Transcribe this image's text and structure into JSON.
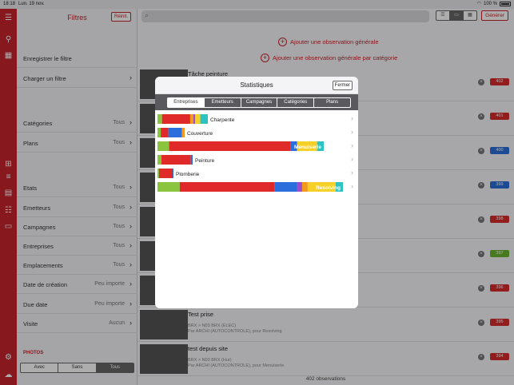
{
  "status_bar": {
    "time": "18:18",
    "date": "Lun. 19 nov.",
    "battery": "100 %"
  },
  "filters": {
    "title": "Filtres",
    "reset_label": "Réinit.",
    "rows": [
      {
        "label": "Enregistrer le filtre",
        "value": "",
        "chevron": false
      },
      {
        "label": "Charger un filtre",
        "value": "",
        "chevron": true
      },
      {
        "label": "Catégories",
        "value": "Tous",
        "chevron": true
      },
      {
        "label": "Plans",
        "value": "Tous",
        "chevron": true
      },
      {
        "label": "Etats",
        "value": "Tous",
        "chevron": true
      },
      {
        "label": "Emetteurs",
        "value": "Tous",
        "chevron": true
      },
      {
        "label": "Campagnes",
        "value": "Tous",
        "chevron": true
      },
      {
        "label": "Entreprises",
        "value": "Tous",
        "chevron": true
      },
      {
        "label": "Emplacements",
        "value": "Tous",
        "chevron": true
      },
      {
        "label": "Date de création",
        "value": "Peu importe",
        "chevron": true
      },
      {
        "label": "Due date",
        "value": "Peu importe",
        "chevron": true
      },
      {
        "label": "Visite",
        "value": "Aucun",
        "chevron": true
      }
    ],
    "photos_label": "PHOTOS",
    "photos_options": [
      "Avec",
      "Sans",
      "Tous"
    ],
    "photos_selected": "Tous"
  },
  "toolbar": {
    "search_placeholder": "",
    "generate_label": "Générer",
    "add_general": "Ajouter une observation générale",
    "add_by_category": "Ajouter une observation générale par catégorie"
  },
  "observations": [
    {
      "name": "Tâche peinture",
      "sub1": "",
      "sub2": "",
      "num": "402",
      "color": "#d72b2b"
    },
    {
      "name": "",
      "sub1": "",
      "sub2": "",
      "num": "401",
      "color": "#d72b2b"
    },
    {
      "name": "",
      "sub1": "",
      "sub2": "",
      "num": "400",
      "color": "#2a6fdb"
    },
    {
      "name": "",
      "sub1": "",
      "sub2": "",
      "num": "399",
      "color": "#2a6fdb"
    },
    {
      "name": "",
      "sub1": "",
      "sub2": "",
      "num": "398",
      "color": "#d72b2b"
    },
    {
      "name": "",
      "sub1": "",
      "sub2": "",
      "num": "397",
      "color": "#6ab52e"
    },
    {
      "name": "",
      "sub1": "",
      "sub2": "",
      "num": "396",
      "color": "#d72b2b"
    },
    {
      "name": "Test prise",
      "sub1": "BRX > N03 BRX (ELEC)",
      "sub2": "Par ARCHI (AUTOCONTROLE), pour Resolving",
      "num": "395",
      "color": "#d72b2b"
    },
    {
      "name": "test depuis site",
      "sub1": "BRX > N03 BRX (Hur)",
      "sub2": "Par ARCHI (AUTOCONTROLE), pour Menuiserie",
      "num": "394",
      "color": "#d72b2b"
    }
  ],
  "footer_count": "402 observations",
  "modal": {
    "title": "Statistiques",
    "close_label": "Fermer",
    "tabs": [
      "Entreprises",
      "Emetteurs",
      "Campagnes",
      "Catégories",
      "Plans"
    ],
    "active_tab": "Entreprises",
    "rows": [
      {
        "label": "Charpente",
        "label_style": "outside",
        "segments": [
          {
            "color": "#8bc43f",
            "frac": 0.09
          },
          {
            "color": "#e02a2a",
            "frac": 0.56
          },
          {
            "color": "#f39a1e",
            "frac": 0.06
          },
          {
            "color": "#9b4fcf",
            "frac": 0.04
          },
          {
            "color": "#f6d027",
            "frac": 0.1
          },
          {
            "color": "#2fc2c2",
            "frac": 0.15
          }
        ]
      },
      {
        "label": "Couverture",
        "label_style": "outside",
        "segments": [
          {
            "color": "#8bc43f",
            "frac": 0.12
          },
          {
            "color": "#e02a2a",
            "frac": 0.28
          },
          {
            "color": "#2a6fdb",
            "frac": 0.5
          },
          {
            "color": "#f39a1e",
            "frac": 0.1
          }
        ]
      },
      {
        "label": "Menuiserie",
        "label_style": "inside",
        "segments": [
          {
            "color": "#8bc43f",
            "frac": 0.07
          },
          {
            "color": "#e02a2a",
            "frac": 0.73
          },
          {
            "color": "#2a6fdb",
            "frac": 0.04
          },
          {
            "color": "#f6d027",
            "frac": 0.12
          },
          {
            "color": "#2fc2c2",
            "frac": 0.04
          }
        ]
      },
      {
        "label": "Peinture",
        "label_style": "outside",
        "segments": [
          {
            "color": "#8bc43f",
            "frac": 0.11
          },
          {
            "color": "#e02a2a",
            "frac": 0.84
          },
          {
            "color": "#2a6fdb",
            "frac": 0.05
          }
        ]
      },
      {
        "label": "Plomberie",
        "label_style": "outside",
        "segments": [
          {
            "color": "#8bc43f",
            "frac": 0.1
          },
          {
            "color": "#e02a2a",
            "frac": 0.85
          },
          {
            "color": "#2a6fdb",
            "frac": 0.05
          }
        ]
      },
      {
        "label": "Resolving",
        "label_style": "inside",
        "segments": [
          {
            "color": "#8bc43f",
            "frac": 0.12
          },
          {
            "color": "#e02a2a",
            "frac": 0.51
          },
          {
            "color": "#2a6fdb",
            "frac": 0.12
          },
          {
            "color": "#9b4fcf",
            "frac": 0.03
          },
          {
            "color": "#f39a1e",
            "frac": 0.03
          },
          {
            "color": "#f6d027",
            "frac": 0.15
          },
          {
            "color": "#2fc2c2",
            "frac": 0.04
          }
        ]
      }
    ]
  }
}
